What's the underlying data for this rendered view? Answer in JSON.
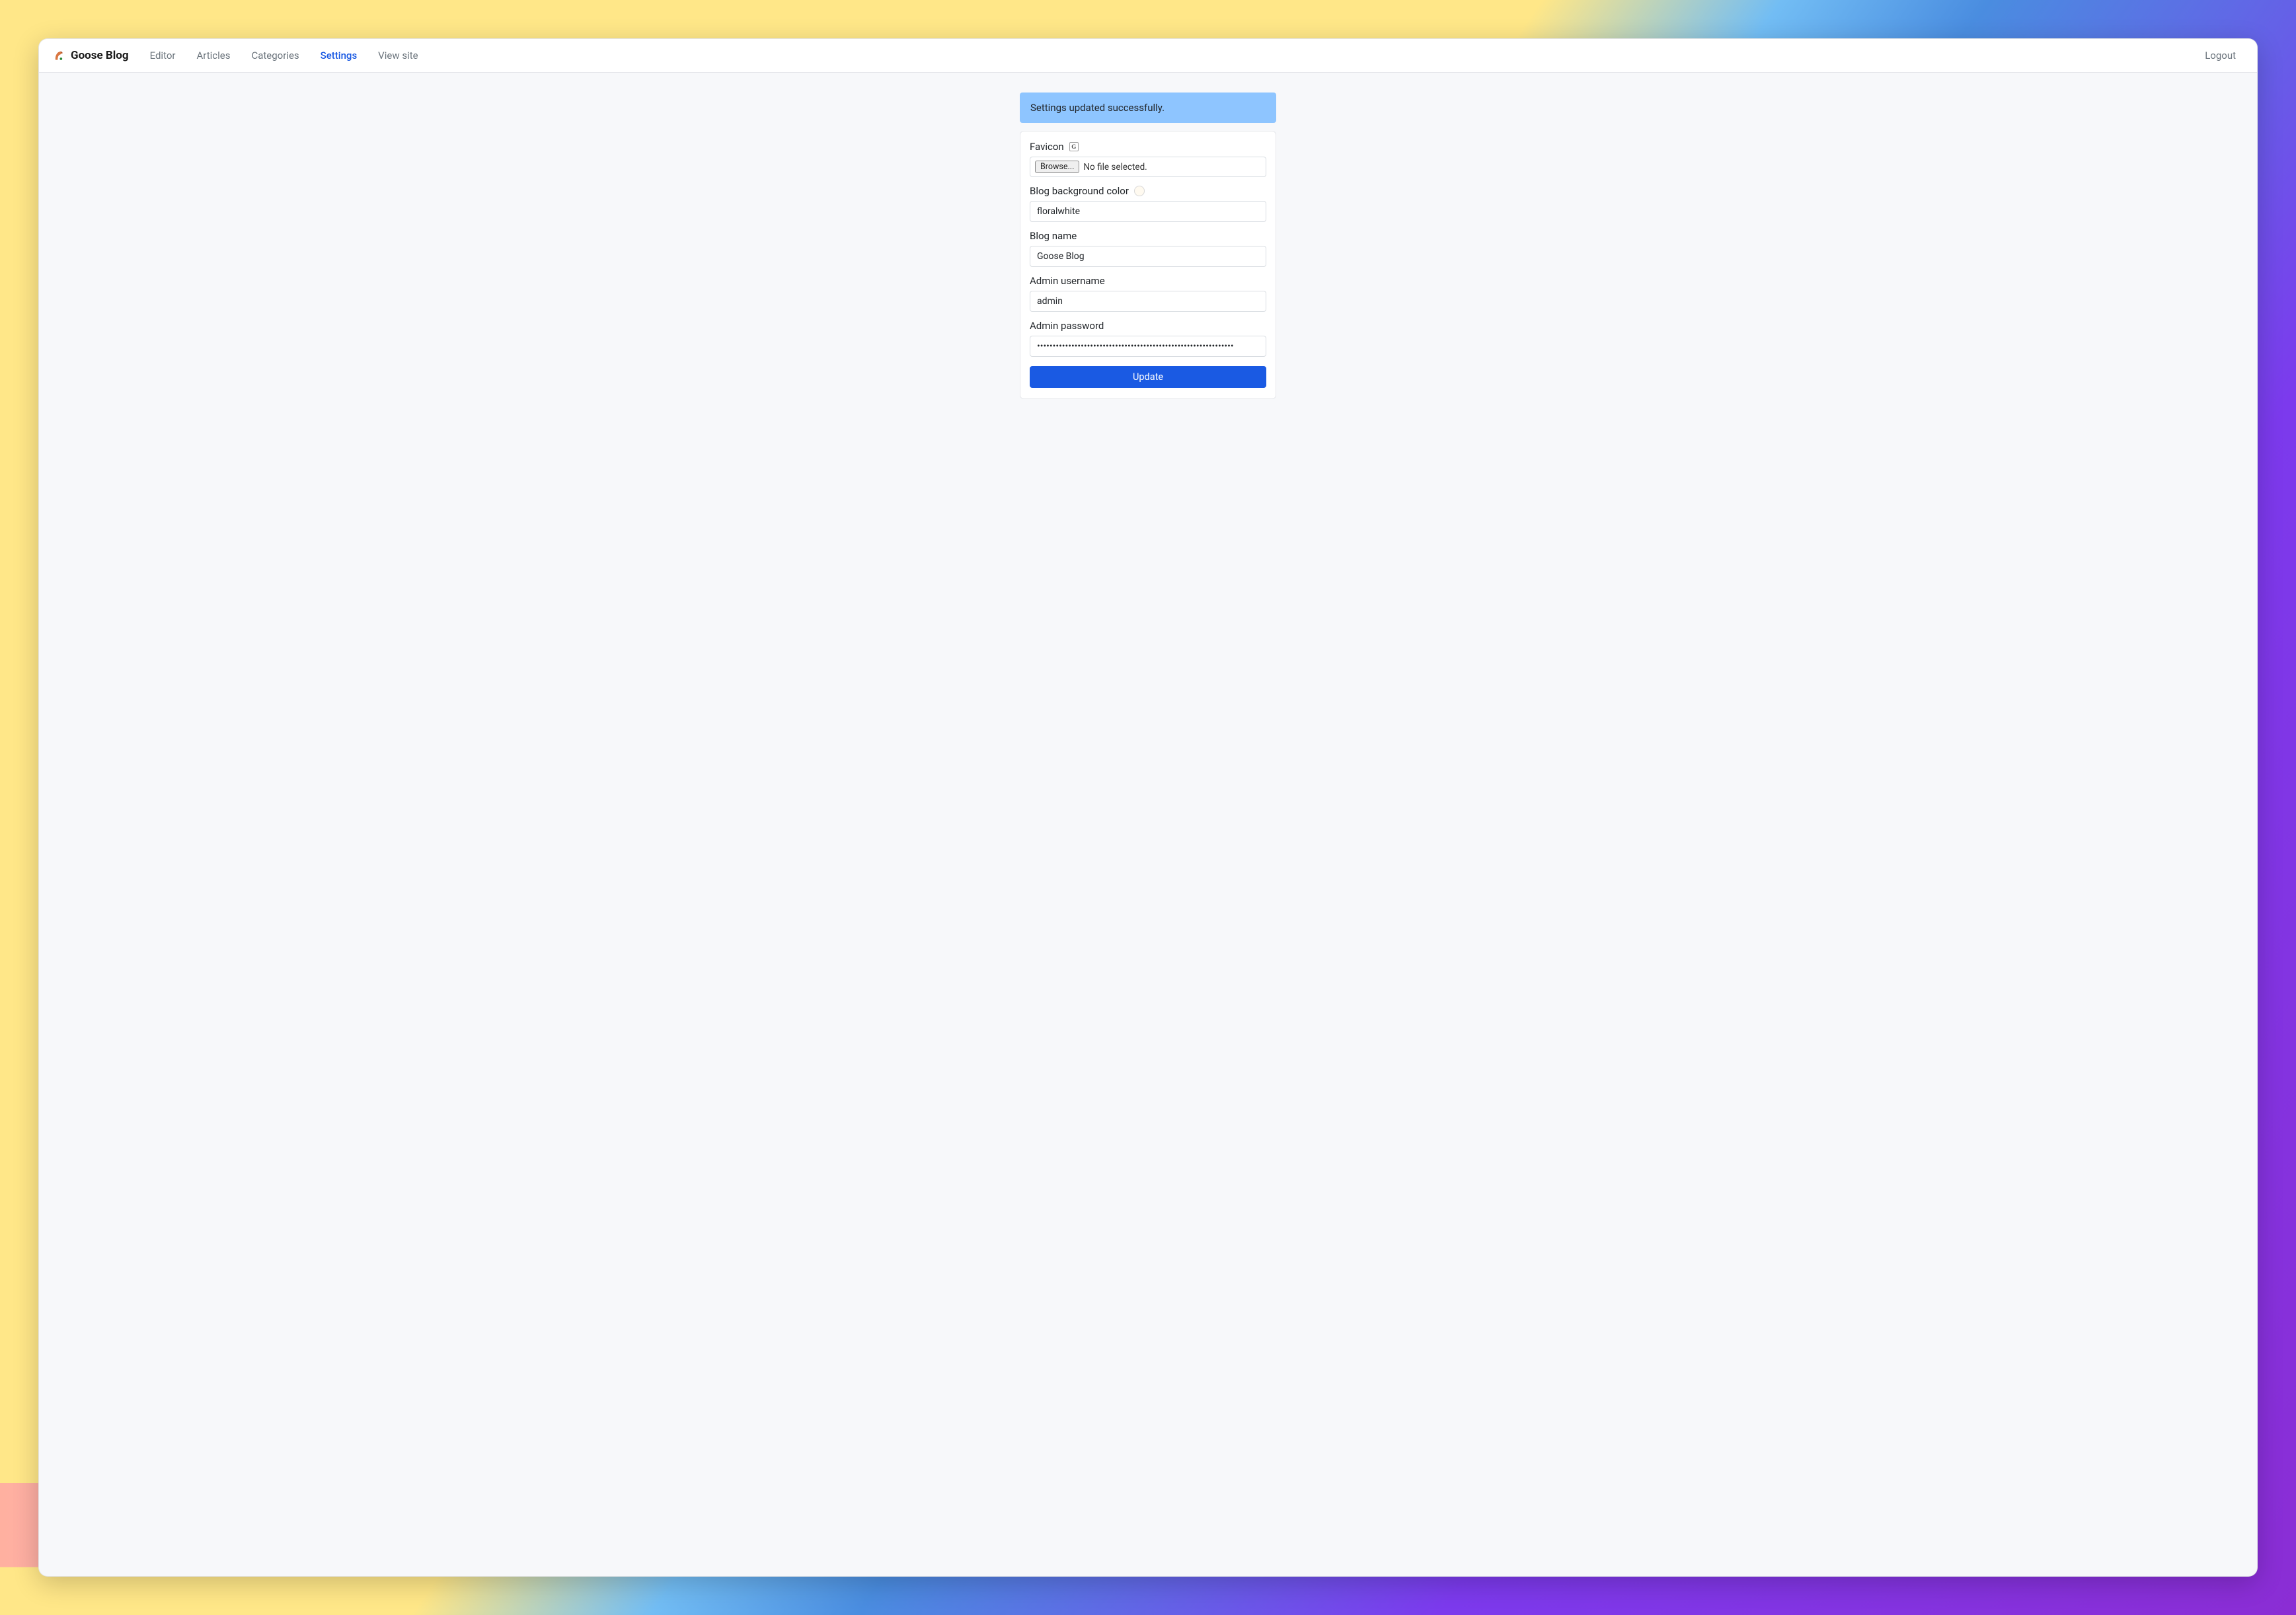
{
  "brand": {
    "name": "Goose Blog"
  },
  "nav": {
    "items": [
      {
        "label": "Editor",
        "active": false
      },
      {
        "label": "Articles",
        "active": false
      },
      {
        "label": "Categories",
        "active": false
      },
      {
        "label": "Settings",
        "active": true
      },
      {
        "label": "View site",
        "active": false
      }
    ],
    "logout": "Logout"
  },
  "alert": {
    "message": "Settings updated successfully."
  },
  "form": {
    "favicon": {
      "label": "Favicon",
      "preview_letter": "G",
      "browse": "Browse...",
      "status": "No file selected."
    },
    "bgcolor": {
      "label": "Blog background color",
      "value": "floralwhite",
      "swatch": "#FFFAF0"
    },
    "blogname": {
      "label": "Blog name",
      "value": "Goose Blog"
    },
    "username": {
      "label": "Admin username",
      "value": "admin"
    },
    "password": {
      "label": "Admin password",
      "value": "•••••••••••••••••••••••••••••••••••••••••••••••••••••••••••••••"
    },
    "submit": "Update"
  }
}
